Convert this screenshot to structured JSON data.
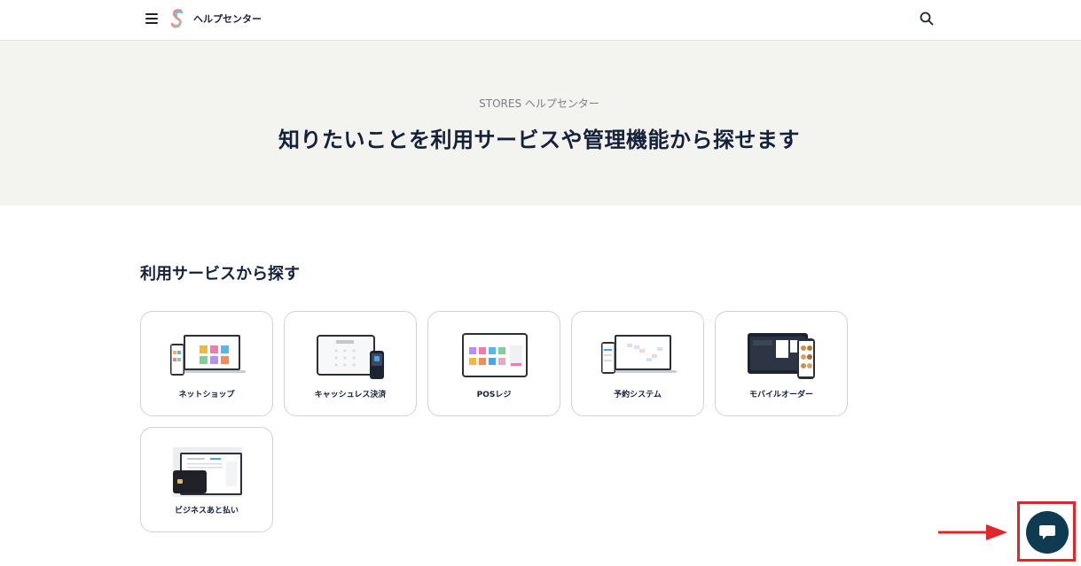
{
  "header": {
    "site_title": "ヘルプセンター",
    "icons": [
      "menu-icon",
      "stores-logo",
      "search-icon"
    ]
  },
  "hero": {
    "subtitle": "STORES ヘルプセンター",
    "title": "知りたいことを利用サービスや管理機能から探せます"
  },
  "services": {
    "section_title": "利用サービスから探す",
    "items": [
      {
        "label": "ネットショップ"
      },
      {
        "label": "キャッシュレス決済"
      },
      {
        "label": "POSレジ"
      },
      {
        "label": "予約システム"
      },
      {
        "label": "モバイルオーダー"
      },
      {
        "label": "ビジネスあと払い"
      }
    ]
  },
  "chat": {
    "icon": "chat-bubble-icon"
  },
  "colors": {
    "accent_dark": "#0e3b52",
    "highlight_red": "#e3242b",
    "hero_bg": "#f3f3f0"
  }
}
